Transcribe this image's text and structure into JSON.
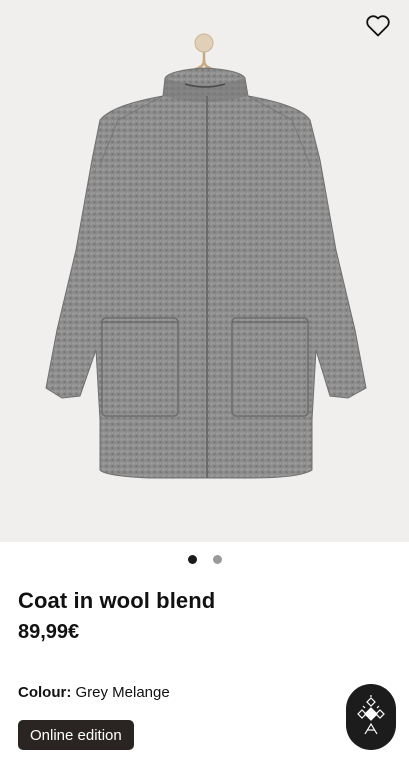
{
  "product": {
    "title": "Coat in wool blend",
    "price": "89,99€",
    "colour_label": "Colour:",
    "colour_value": "Grey Melange",
    "edition_badge": "Online edition"
  },
  "gallery": {
    "image_count": 2,
    "active_index": 0,
    "image_subject": "grey wool blend coat on hanger"
  },
  "icons": {
    "wishlist": "heart-icon",
    "brand": "brand-logo-icon"
  },
  "colors": {
    "background": "#f1efee",
    "coat": "#8a8a8a",
    "badge": "#2a2523",
    "dot_active": "#1a1a1a",
    "dot_inactive": "#9a9a9a"
  }
}
